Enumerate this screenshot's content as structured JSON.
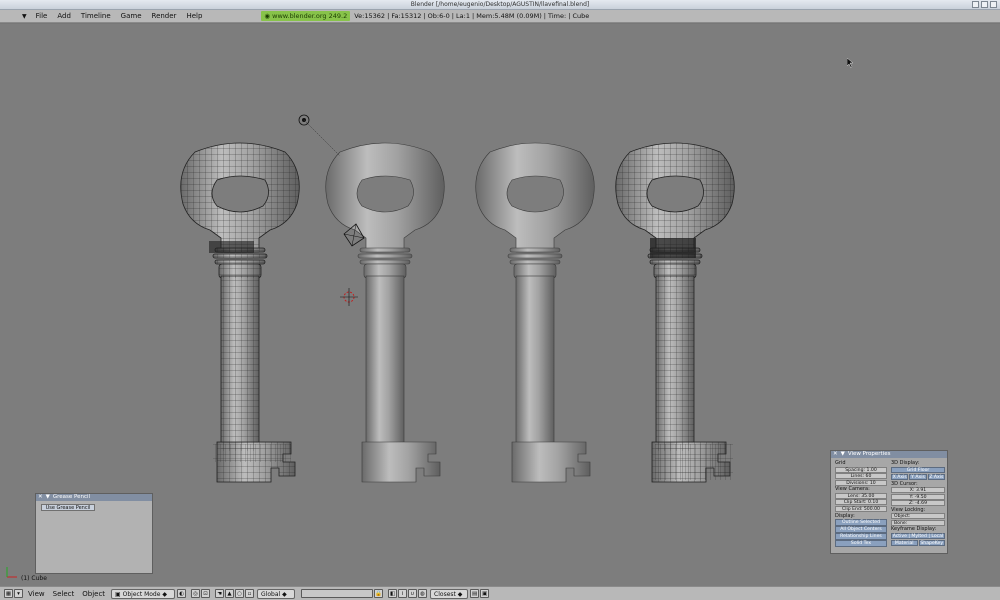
{
  "window": {
    "title": "Blender [/home/eugenio/Desktop/AGUSTIN/llavefinal.blend]"
  },
  "menu": {
    "items": [
      "File",
      "Add",
      "Timeline",
      "Game",
      "Render",
      "Help"
    ]
  },
  "info": {
    "site": "www.blender.org 249.2",
    "stats": "Ve:15362 | Fa:15312 | Ob:6-0 | La:1  | Mem:5.48M (0.09M) | Time: | Cube"
  },
  "viewport": {
    "object_label": "(1) Cube"
  },
  "grease_pencil": {
    "title": "Grease Pencil",
    "button": "Use Grease Pencil"
  },
  "view_properties": {
    "title": "View Properties",
    "grid": {
      "label": "Grid",
      "spacing": "Spacing: 1.00",
      "lines": "Lines: 60",
      "divisions": "Divisions: 10"
    },
    "view_camera": {
      "label": "View Camera:",
      "lens": "Lens: 35.00",
      "clip_start": "Clip Start: 0.10",
      "clip_end": "Clip End: 500.00"
    },
    "display": {
      "label": "Display:",
      "outline": "Outline Selected",
      "centers": "All Object Centers",
      "relationship": "Relationship Lines",
      "solid_tex": "Solid Tex"
    },
    "display_3d": {
      "label": "3D Display:",
      "grid_floor": "Grid Floor",
      "x_axis": "X Axis",
      "y_axis": "Y Axis",
      "z_axis": "Z Axis"
    },
    "cursor_3d": {
      "label": "3D Cursor:",
      "x": "X: 3.91",
      "y": "Y: -9.50",
      "z": "Z: -4.69"
    },
    "view_locking": {
      "label": "View Locking:",
      "object": "Object:",
      "bone": "Bone:"
    },
    "keyframe": {
      "label": "Keyframe Display:",
      "modes": "Active | Mylted | Local",
      "material": "Material",
      "shapekey": "ShapeKey"
    }
  },
  "bottom": {
    "menus": [
      "View",
      "Select",
      "Object"
    ],
    "mode": "Object Mode",
    "orientation": "Global",
    "snap": "Closest"
  }
}
